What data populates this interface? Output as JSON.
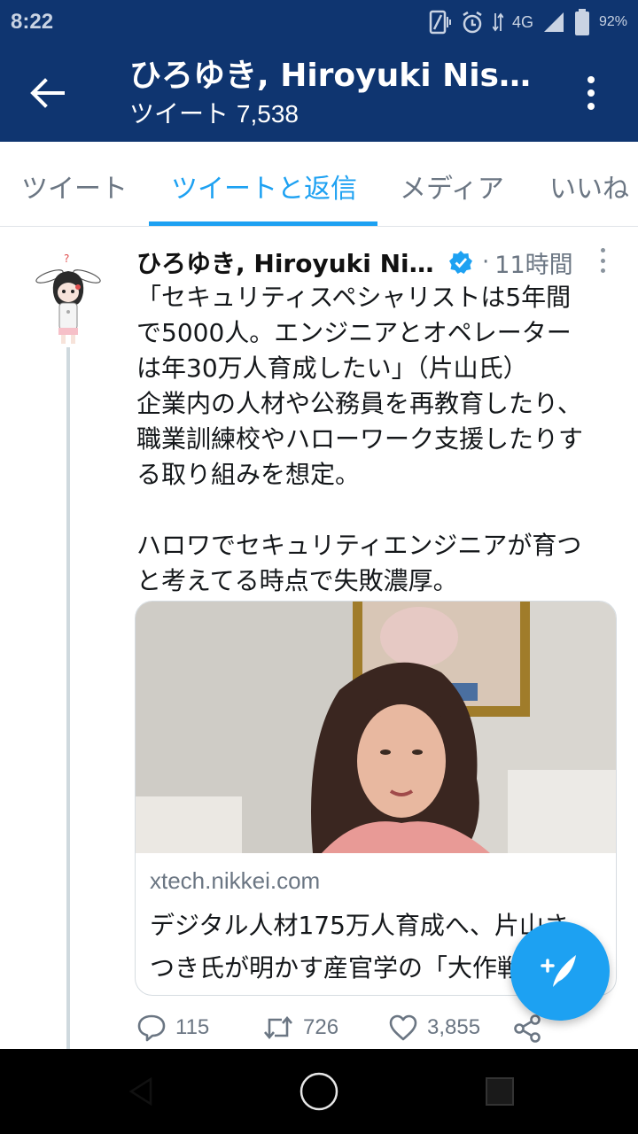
{
  "status_bar": {
    "time": "8:22",
    "network": "4G",
    "battery": "92%"
  },
  "app_bar": {
    "title": "ひろゆき, Hiroyuki Nis…",
    "subtitle_label": "ツイート",
    "tweet_count": "7,538"
  },
  "tabs": [
    {
      "label": "ツイート",
      "active": false
    },
    {
      "label": "ツイートと返信",
      "active": true
    },
    {
      "label": "メディア",
      "active": false
    },
    {
      "label": "いいね",
      "active": false
    }
  ],
  "tweet": {
    "author": "ひろゆき, Hiroyuki Nishi…",
    "separator": "·",
    "time": "11時間",
    "text_lines": [
      "「セキュリティスペシャリストは5年間",
      "で5000人。エンジニアとオペレーター",
      "は年30万人育成したい」（片山氏）",
      "企業内の人材や公務員を再教育したり、",
      "職業訓練校やハローワーク支援したりす",
      "る取り組みを想定。",
      "ハロワでセキュリティエンジニアが育つ",
      "と考えてる時点で失敗濃厚。"
    ],
    "card": {
      "domain": "xtech.nikkei.com",
      "title_line1": "デジタル人材175万人育成へ、片山さ",
      "title_line2": "つき氏が明かす産官学の「大作戦」"
    },
    "actions": {
      "replies": "115",
      "retweets": "726",
      "likes": "3,855"
    }
  },
  "colors": {
    "header_bg": "#0f3570",
    "accent": "#1da1f2",
    "muted": "#6b7683"
  },
  "icons": [
    "back-arrow-icon",
    "more-vertical-icon",
    "verified-badge-icon",
    "reply-icon",
    "retweet-icon",
    "like-icon",
    "share-icon",
    "compose-icon"
  ]
}
